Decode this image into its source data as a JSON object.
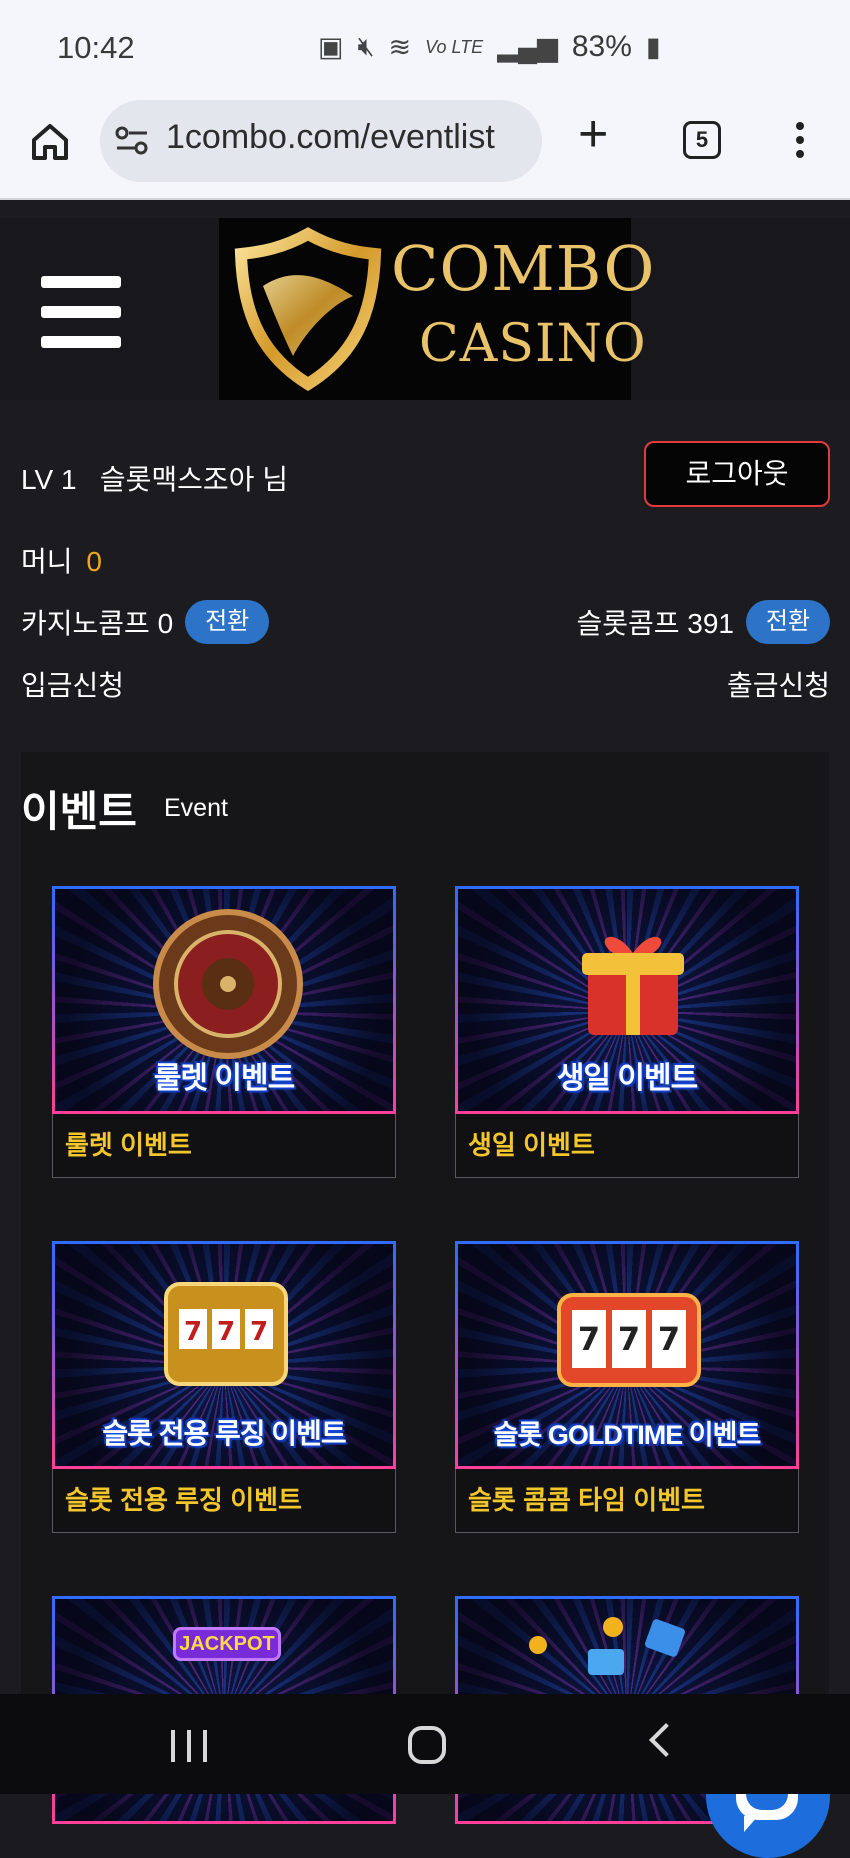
{
  "status_bar": {
    "time": "10:42",
    "battery": "83%"
  },
  "browser": {
    "url": "1combo.com/eventlist",
    "tab_count": "5"
  },
  "site": {
    "logo": {
      "line1": "COMBO",
      "line2": "CASINO"
    },
    "user": {
      "level": "LV 1",
      "name": "슬롯맥스조아 님"
    },
    "logout_label": "로그아웃",
    "money": {
      "label": "머니",
      "value": "0"
    },
    "casino_comp": {
      "label": "카지노콤프",
      "value": "0",
      "button": "전환"
    },
    "slot_comp": {
      "label": "슬롯콤프",
      "value": "391",
      "button": "전환"
    },
    "deposit_label": "입금신청",
    "withdraw_label": "출금신청"
  },
  "events": {
    "title": "이벤트",
    "subtitle": "Event",
    "items": [
      {
        "image_text": "룰렛 이벤트",
        "caption": "룰렛 이벤트",
        "icon": "roulette-icon"
      },
      {
        "image_text": "생일 이벤트",
        "caption": "생일 이벤트",
        "icon": "gift-icon"
      },
      {
        "image_text": "슬롯 전용 루징 이벤트",
        "caption": "슬롯 전용 루징 이벤트",
        "icon": "slot-machine-icon"
      },
      {
        "image_text": "슬롯 GOLDTIME 이벤트",
        "caption": "슬롯 콤콤 타임 이벤트",
        "icon": "slot-777-icon"
      },
      {
        "image_text": "JACKPOT",
        "caption": "",
        "icon": "jackpot-icon"
      },
      {
        "image_text": "",
        "caption": "",
        "icon": "gift-boxes-icon"
      }
    ]
  },
  "colors": {
    "accent_gold": "#f3c62c",
    "money_orange": "#f0a818",
    "button_blue": "#2d74c8",
    "logout_border": "#e13b3b",
    "chat_blue": "#1d6ddc"
  }
}
